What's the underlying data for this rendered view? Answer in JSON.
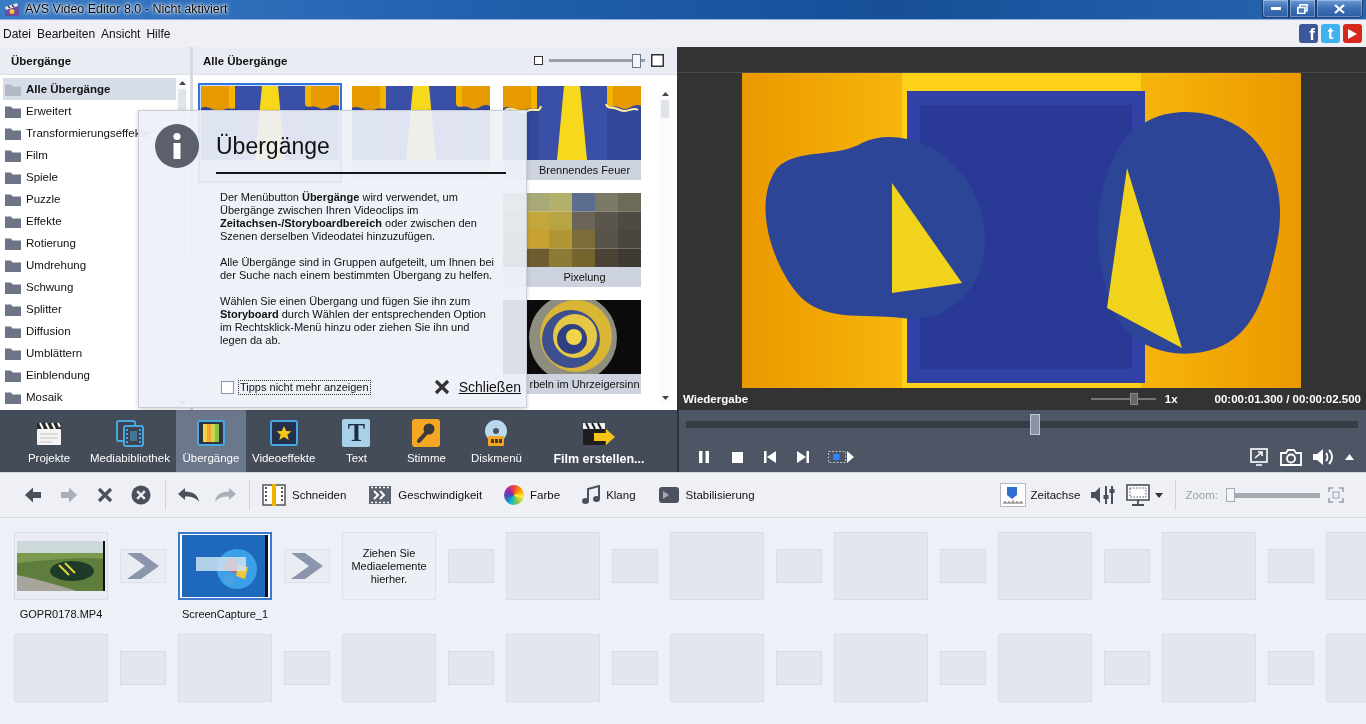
{
  "window": {
    "title": "AVS Video Editor 8.0 - Nicht aktiviert"
  },
  "menu": [
    "Datei",
    "Bearbeiten",
    "Ansicht",
    "Hilfe"
  ],
  "social": [
    {
      "kind": "facebook",
      "glyph": "f"
    },
    {
      "kind": "twitter",
      "glyph": "t"
    },
    {
      "kind": "youtube"
    }
  ],
  "categories": {
    "title": "Übergänge",
    "items": [
      {
        "label": "Alle Übergänge",
        "selected": true
      },
      {
        "label": "Erweitert",
        "selected": false
      },
      {
        "label": "Transformierungseffekte",
        "selected": false
      },
      {
        "label": "Film",
        "selected": false
      },
      {
        "label": "Spiele",
        "selected": false
      },
      {
        "label": "Puzzle",
        "selected": false
      },
      {
        "label": "Effekte",
        "selected": false
      },
      {
        "label": "Rotierung",
        "selected": false
      },
      {
        "label": "Umdrehung",
        "selected": false
      },
      {
        "label": "Schwung",
        "selected": false
      },
      {
        "label": "Splitter",
        "selected": false
      },
      {
        "label": "Diffusion",
        "selected": false
      },
      {
        "label": "Umblättern",
        "selected": false
      },
      {
        "label": "Einblendung",
        "selected": false
      },
      {
        "label": "Mosaik",
        "selected": false
      }
    ]
  },
  "gallery": {
    "title": "Alle Übergänge",
    "size": {
      "level": 0.95
    },
    "rows": [
      {
        "tiles": [
          {
            "kind": "burn",
            "selected": true
          },
          {
            "kind": "burn",
            "selected": false
          },
          {
            "kind": "fire",
            "label": "Brennendes Feuer",
            "selected": false
          }
        ]
      },
      {
        "tiles": [
          {
            "kind": "pixel",
            "label": "Pixelung",
            "selected": false
          }
        ]
      },
      {
        "tiles": [
          {
            "kind": "swirl",
            "label": "rbeln im Uhrzeigersinn",
            "selected": false
          }
        ]
      }
    ]
  },
  "tip": {
    "title": "Übergänge",
    "paragraphs": [
      "Der Menübutton **Übergänge** wird verwendet, um Übergänge zwischen Ihren Videoclips im **Zeitachsen-/Storyboardbereich** oder zwischen den Szenen derselben Videodatei hinzuzufügen.",
      "Alle Übergänge sind in Gruppen aufgeteilt, um Ihnen bei der Suche nach einem bestimmten Übergang zu helfen.",
      "Wählen Sie einen Übergang und fügen Sie ihn zum **Storyboard** durch Wählen der entsprechenden Option im Rechtsklick-Menü hinzu oder ziehen Sie ihn und legen da ab."
    ],
    "dont_show": {
      "label": "Tipps nicht mehr anzeigen",
      "checked": false,
      "focused": true
    },
    "close": "Schließen"
  },
  "player": {
    "title": "Wiedergabe",
    "speed": {
      "level": 0.68,
      "reading": "1x"
    },
    "time": "00:00:01.300 / 00:00:02.500",
    "seek": {
      "level": 0.52
    },
    "controls": [
      {
        "kind": "pause"
      },
      {
        "kind": "stop"
      },
      {
        "kind": "previous"
      },
      {
        "kind": "next"
      },
      {
        "kind": "preview-mode"
      }
    ],
    "tools": [
      {
        "kind": "fullscreen"
      },
      {
        "kind": "snapshot"
      },
      {
        "kind": "volume"
      },
      {
        "kind": "expand"
      }
    ]
  },
  "modules": [
    {
      "kind": "projects",
      "label": "Projekte",
      "selected": false
    },
    {
      "kind": "media",
      "label": "Mediabibliothek",
      "selected": false
    },
    {
      "kind": "transitions",
      "label": "Übergänge",
      "selected": true
    },
    {
      "kind": "effects",
      "label": "Videoeffekte",
      "selected": false
    },
    {
      "kind": "text",
      "label": "Text",
      "glyph": "T",
      "selected": false
    },
    {
      "kind": "voice",
      "label": "Stimme",
      "selected": false
    },
    {
      "kind": "disc",
      "label": "Diskmenü",
      "selected": false
    },
    {
      "kind": "produce",
      "label": "Film erstellen...",
      "selected": false
    }
  ],
  "toolbar": {
    "edit": [
      {
        "kind": "back",
        "disabled": false
      },
      {
        "kind": "forward",
        "disabled": true
      },
      {
        "kind": "delete",
        "disabled": false
      },
      {
        "kind": "delete-all",
        "disabled": false
      }
    ],
    "history": [
      {
        "kind": "undo",
        "disabled": false
      },
      {
        "kind": "redo",
        "disabled": true
      }
    ],
    "tools": [
      {
        "kind": "trim",
        "label": "Schneiden"
      },
      {
        "kind": "speed",
        "label": "Geschwindigkeit"
      },
      {
        "kind": "color",
        "label": "Farbe"
      },
      {
        "kind": "audio",
        "label": "Klang"
      },
      {
        "kind": "stabilize",
        "label": "Stabilisierung"
      }
    ],
    "view": [
      {
        "kind": "timeline",
        "label": "Zeitachse"
      },
      {
        "kind": "mixer"
      },
      {
        "kind": "monitor"
      }
    ],
    "zoom": {
      "label": "Zoom:",
      "disabled": true,
      "level": 0
    }
  },
  "storyboard": {
    "clips": [
      {
        "kind": "video",
        "label": "GOPR0178.MP4",
        "selected": false
      },
      {
        "kind": "screen",
        "label": "ScreenCapture_1",
        "selected": true
      }
    ],
    "drop_hint": "Ziehen Sie Mediaelemente hierher."
  }
}
